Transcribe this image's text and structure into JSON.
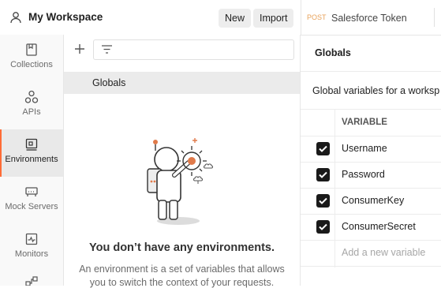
{
  "header": {
    "workspace_name": "My Workspace",
    "new_label": "New",
    "import_label": "Import"
  },
  "tab": {
    "method": "POST",
    "name": "Salesforce Token"
  },
  "rail": {
    "items": [
      {
        "label": "Collections",
        "icon": "collections-icon"
      },
      {
        "label": "APIs",
        "icon": "apis-icon"
      },
      {
        "label": "Environments",
        "icon": "environments-icon",
        "active": true
      },
      {
        "label": "Mock Servers",
        "icon": "mock-servers-icon"
      },
      {
        "label": "Monitors",
        "icon": "monitors-icon"
      }
    ]
  },
  "env_list": {
    "globals_label": "Globals"
  },
  "empty_state": {
    "title": "You don’t have any environments.",
    "line1": "An environment is a set of variables that allows",
    "line2": "you to switch the context of your requests."
  },
  "globals": {
    "title": "Globals",
    "description": "Global variables for a worksp",
    "column_variable": "VARIABLE",
    "variables": [
      {
        "name": "Username",
        "enabled": true
      },
      {
        "name": "Password",
        "enabled": true
      },
      {
        "name": "ConsumerKey",
        "enabled": true
      },
      {
        "name": "ConsumerSecret",
        "enabled": true
      }
    ],
    "add_placeholder": "Add a new variable"
  },
  "colors": {
    "accent": "#ff6c37",
    "method_post": "#e8a25a",
    "checkbox": "#1a1a1a"
  }
}
